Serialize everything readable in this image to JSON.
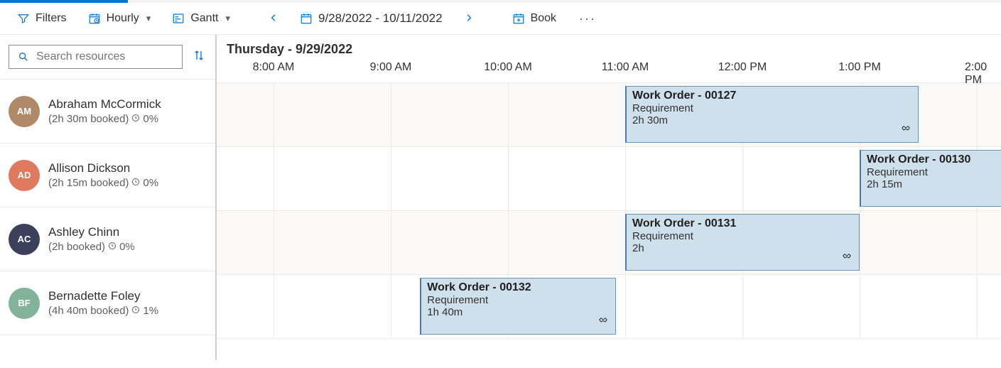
{
  "toolbar": {
    "filters": "Filters",
    "hourly": "Hourly",
    "gantt": "Gantt",
    "dateRange": "9/28/2022 - 10/11/2022",
    "book": "Book"
  },
  "search": {
    "placeholder": "Search resources"
  },
  "dayHeader": "Thursday - 9/29/2022",
  "hours": [
    "8:00 AM",
    "9:00 AM",
    "10:00 AM",
    "11:00 AM",
    "12:00 PM",
    "1:00 PM",
    "2:00 PM"
  ],
  "hourWidthPx": 165,
  "firstTickOffsetPx": 80,
  "resources": [
    {
      "name": "Abraham McCormick",
      "booked": "(2h 30m booked)",
      "util": "0%",
      "avatarBg": "#b08968",
      "initials": "AM"
    },
    {
      "name": "Allison Dickson",
      "booked": "(2h 15m booked)",
      "util": "0%",
      "avatarBg": "#e07a5f",
      "initials": "AD"
    },
    {
      "name": "Ashley Chinn",
      "booked": "(2h booked)",
      "util": "0%",
      "avatarBg": "#3d405b",
      "initials": "AC"
    },
    {
      "name": "Bernadette Foley",
      "booked": "(4h 40m booked)",
      "util": "1%",
      "avatarBg": "#81b29a",
      "initials": "BF"
    }
  ],
  "bookings": [
    {
      "row": 0,
      "title": "Work Order - 00127",
      "sub": "Requirement",
      "dur": "2h 30m",
      "startHourIndex": 3,
      "durationHours": 2.5,
      "showIcon": true
    },
    {
      "row": 1,
      "title": "Work Order - 00130",
      "sub": "Requirement",
      "dur": "2h 15m",
      "startHourIndex": 5,
      "durationHours": 2.25,
      "showIcon": false
    },
    {
      "row": 2,
      "title": "Work Order - 00131",
      "sub": "Requirement",
      "dur": "2h",
      "startHourIndex": 3,
      "durationHours": 2.0,
      "showIcon": true
    },
    {
      "row": 3,
      "title": "Work Order - 00132",
      "sub": "Requirement",
      "dur": "1h 40m",
      "startHourIndex": 1.25,
      "durationHours": 1.67,
      "showIcon": true
    }
  ]
}
